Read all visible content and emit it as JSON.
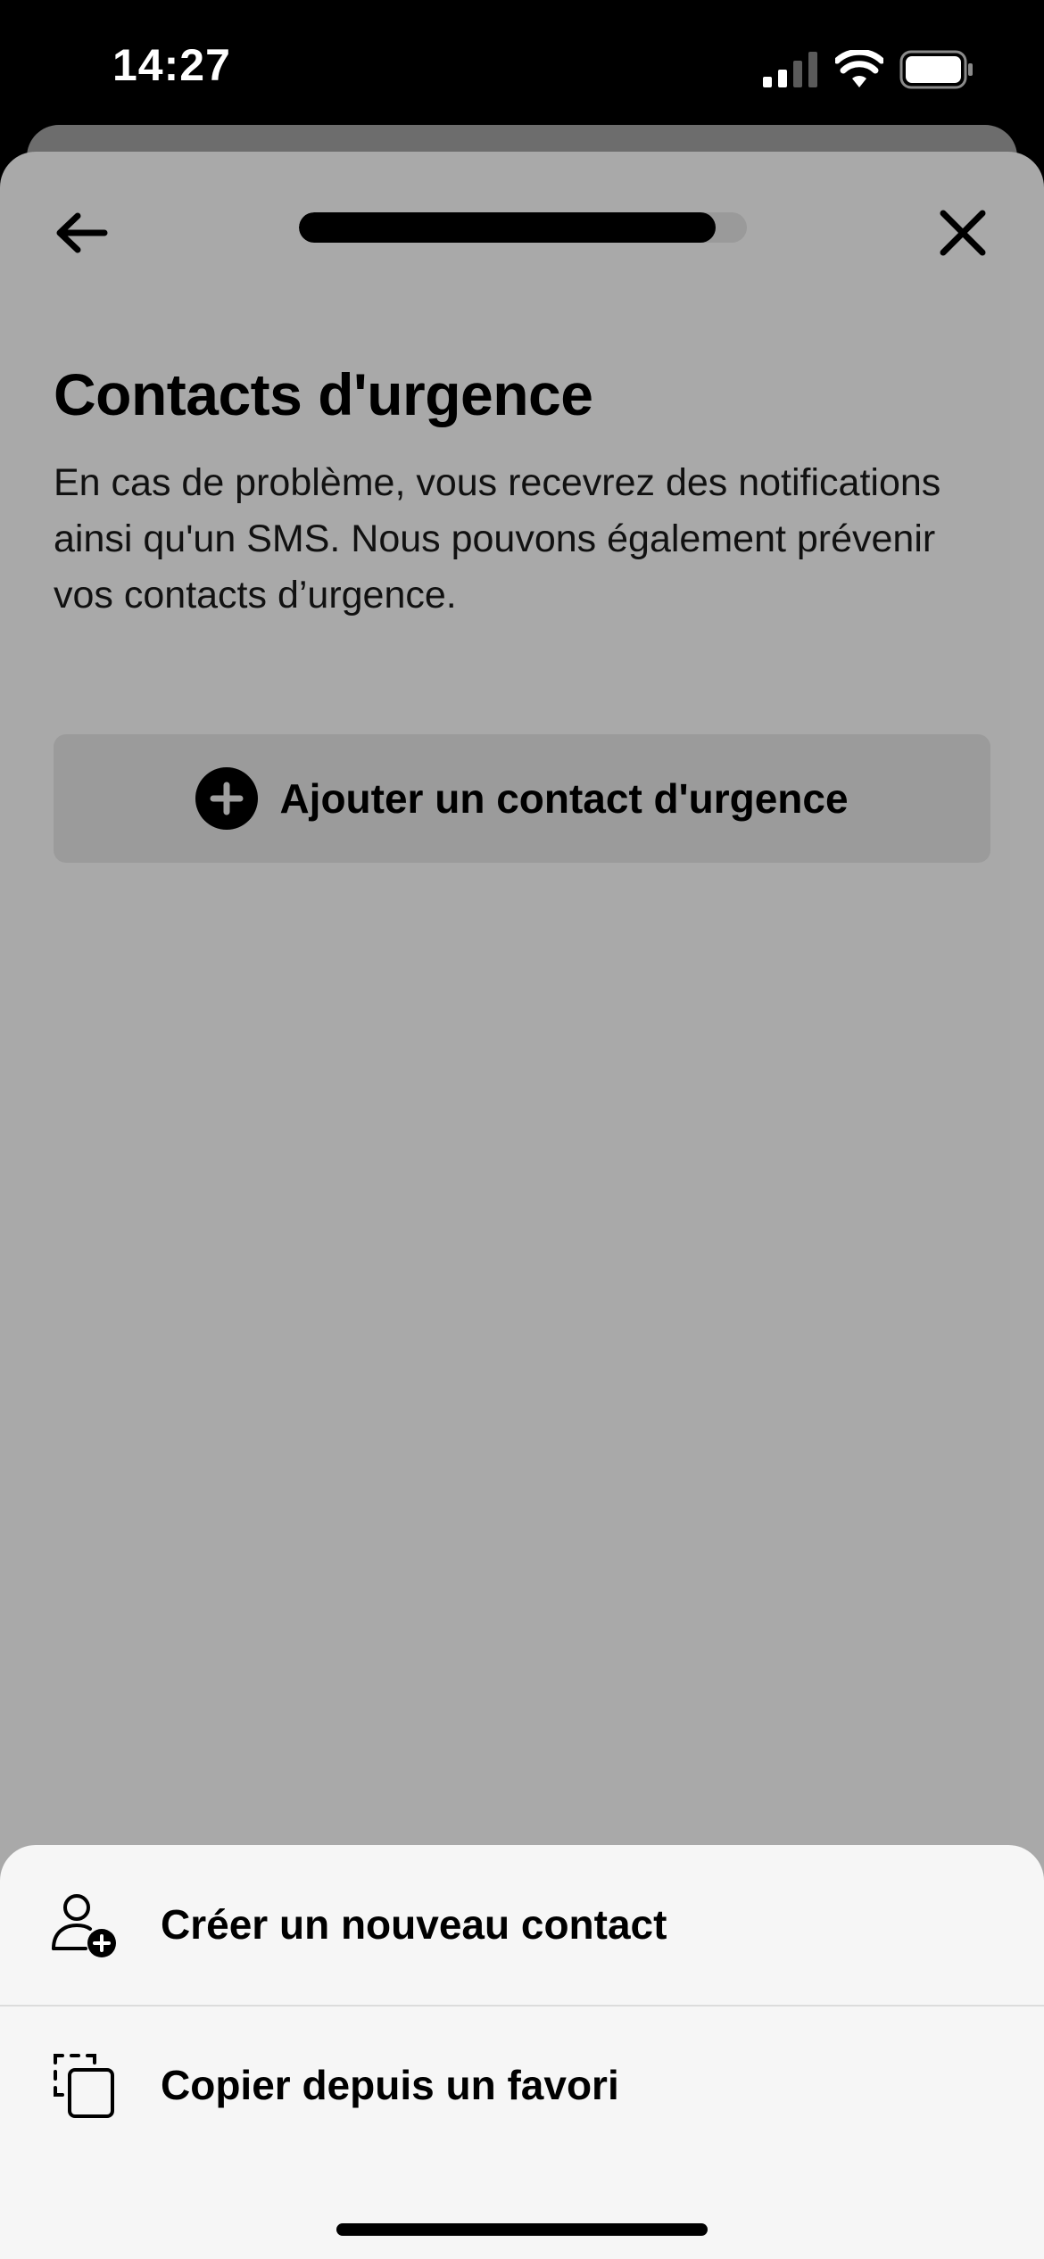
{
  "status_bar": {
    "time": "14:27",
    "icons": [
      "cellular-signal-icon",
      "wifi-icon",
      "battery-icon"
    ]
  },
  "header": {
    "back_icon": "arrow-left-icon",
    "close_icon": "close-icon",
    "progress": 0.93
  },
  "main": {
    "title": "Contacts d'urgence",
    "description": "En cas de problème, vous recevrez des notifications ainsi qu'un SMS. Nous pouvons également prévenir vos contacts d’urgence.",
    "add_contact_label": "Ajouter un contact d'urgence",
    "add_contact_icon": "plus-circle-icon"
  },
  "action_sheet": {
    "items": [
      {
        "label": "Créer un nouveau contact",
        "icon": "add-person-icon"
      },
      {
        "label": "Copier depuis un favori",
        "icon": "copy-icon"
      }
    ]
  },
  "colors": {
    "overlay_sheet": "#a9a9a9",
    "button_bg": "#9b9b9b",
    "action_sheet_bg": "#f6f6f6",
    "text": "#000000"
  }
}
